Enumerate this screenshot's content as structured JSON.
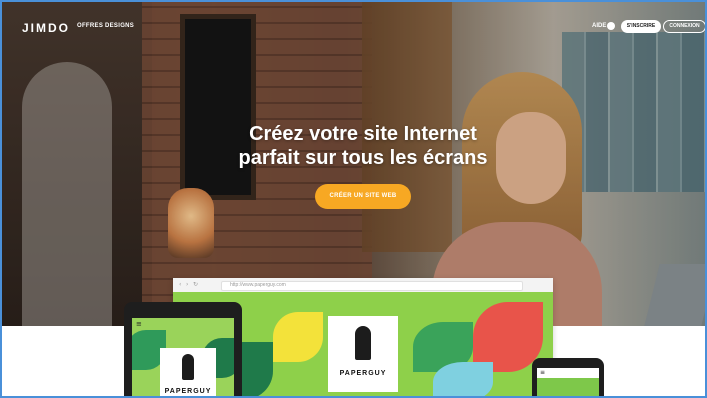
{
  "nav": {
    "logo": "JIMDO",
    "links": [
      "OFFRES",
      "DESIGNS"
    ],
    "help": "AIDE",
    "signup": "S'INSCRIRE",
    "login": "CONNEXION"
  },
  "hero": {
    "headline_line1": "Créez votre site Internet",
    "headline_line2": "parfait sur tous les écrans",
    "cta": "CRÉER UN SITE WEB"
  },
  "devices": {
    "browser_url": "http://www.paperguy.com",
    "brand_desktop": "PAPERGUY",
    "brand_tablet": "PAPERGUY"
  },
  "colors": {
    "cta": "#f7a823",
    "frame": "#4a90d9",
    "art_green": "#8ed04a"
  },
  "icons": {
    "help": "globe-icon",
    "menu": "hamburger-icon",
    "brand": "bird-icon"
  }
}
